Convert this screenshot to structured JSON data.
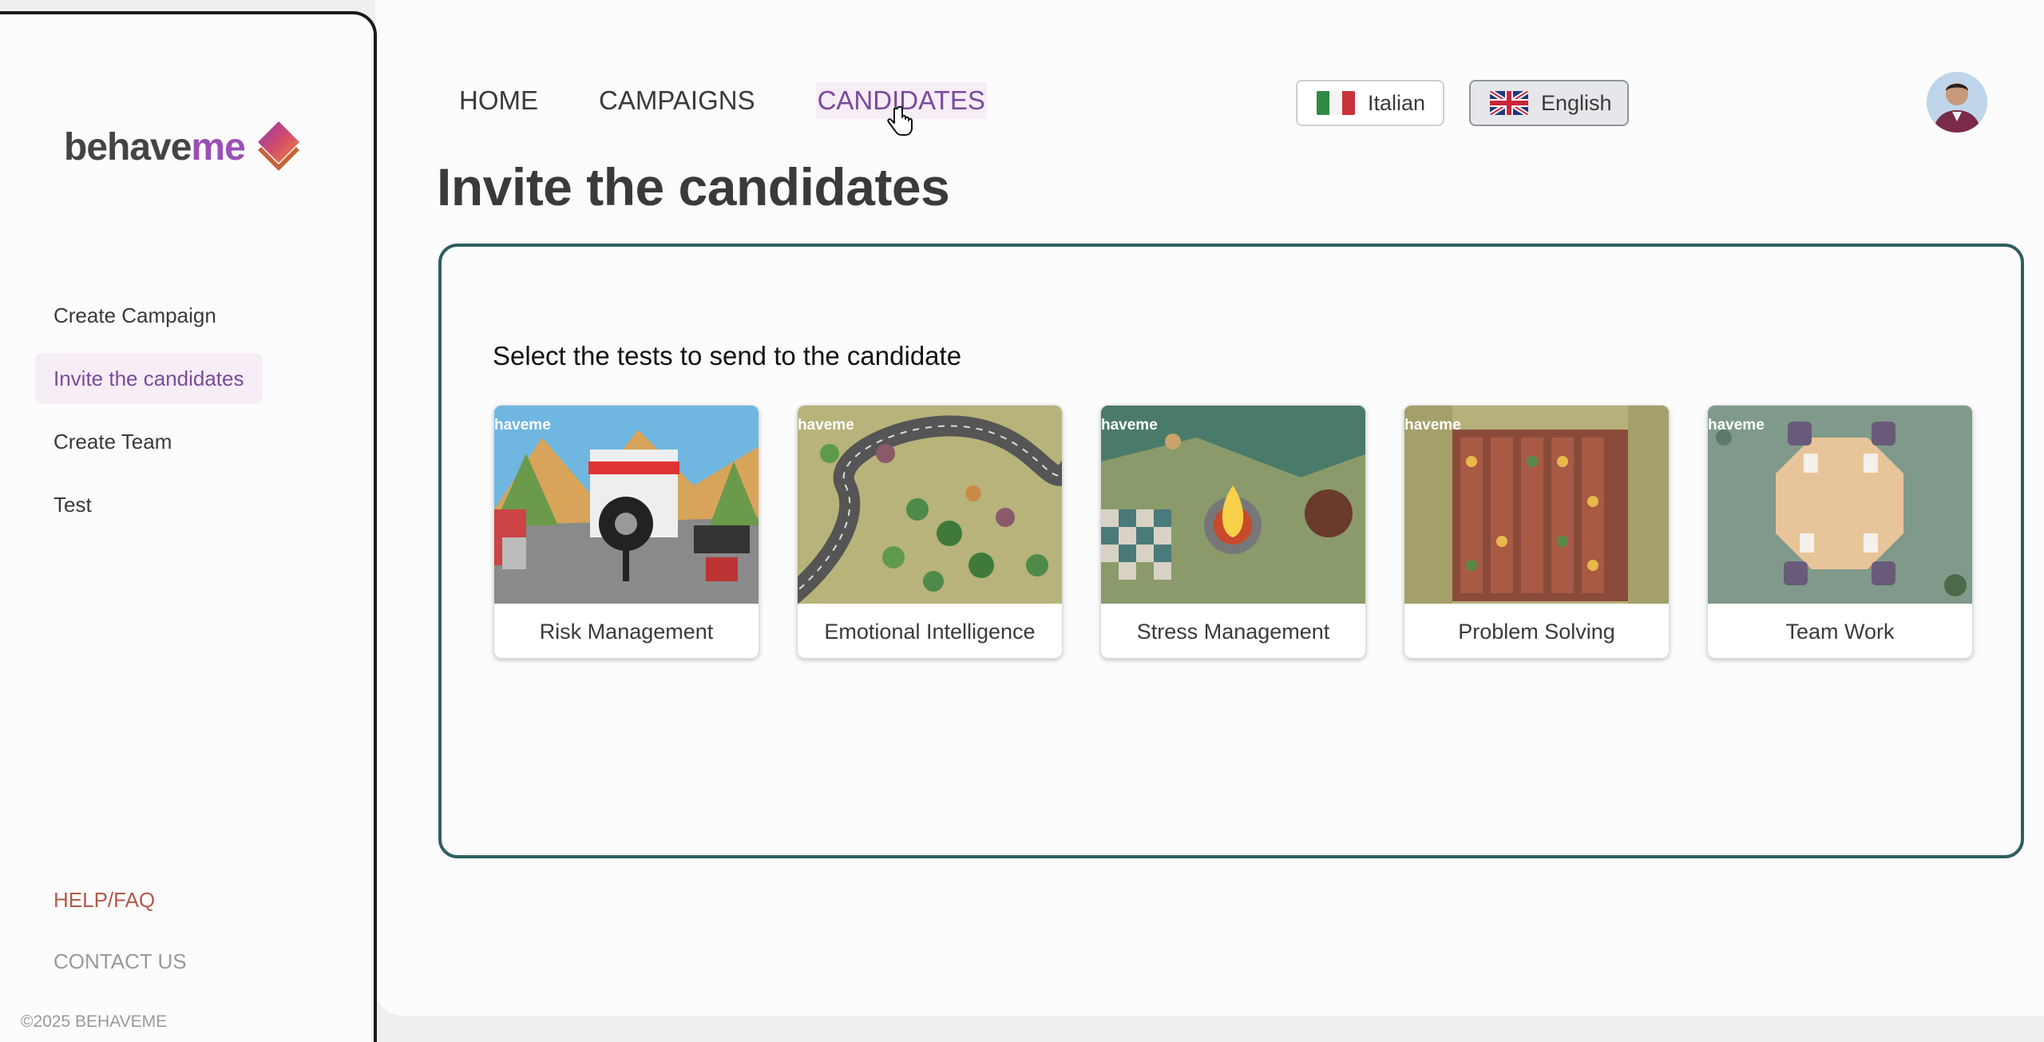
{
  "brand": {
    "logo_part1": "behave",
    "logo_part2": "me",
    "copyright": "©2025 BEHAVEME"
  },
  "sidebar": {
    "items": [
      {
        "label": "Create Campaign",
        "active": false
      },
      {
        "label": "Invite the candidates",
        "active": true
      },
      {
        "label": "Create Team",
        "active": false
      },
      {
        "label": "Test",
        "active": false
      }
    ],
    "help": "HELP/FAQ",
    "contact": "CONTACT US"
  },
  "topnav": {
    "items": [
      {
        "label": "HOME"
      },
      {
        "label": "CAMPAIGNS"
      },
      {
        "label": "CANDIDATES",
        "current": true
      }
    ]
  },
  "languages": {
    "italian": "Italian",
    "english": "English",
    "selected": "English"
  },
  "page": {
    "title": "Invite the candidates",
    "select_label": "Select the tests to send to the candidate"
  },
  "tests": [
    {
      "label": "Risk Management",
      "watermark": "haveme",
      "image_icon": "gas-station-scene"
    },
    {
      "label": "Emotional Intelligence",
      "watermark": "haveme",
      "image_icon": "forest-road-scene"
    },
    {
      "label": "Stress Management",
      "watermark": "haveme",
      "image_icon": "campfire-scene"
    },
    {
      "label": "Problem Solving",
      "watermark": "haveme",
      "image_icon": "garden-beds-scene"
    },
    {
      "label": "Team Work",
      "watermark": "haveme",
      "image_icon": "meeting-table-scene"
    }
  ],
  "colors": {
    "accent_purple": "#7a4a9c",
    "card_border": "#2f5f60",
    "help_red": "#b25a4a",
    "active_bg": "#f6edf6"
  }
}
